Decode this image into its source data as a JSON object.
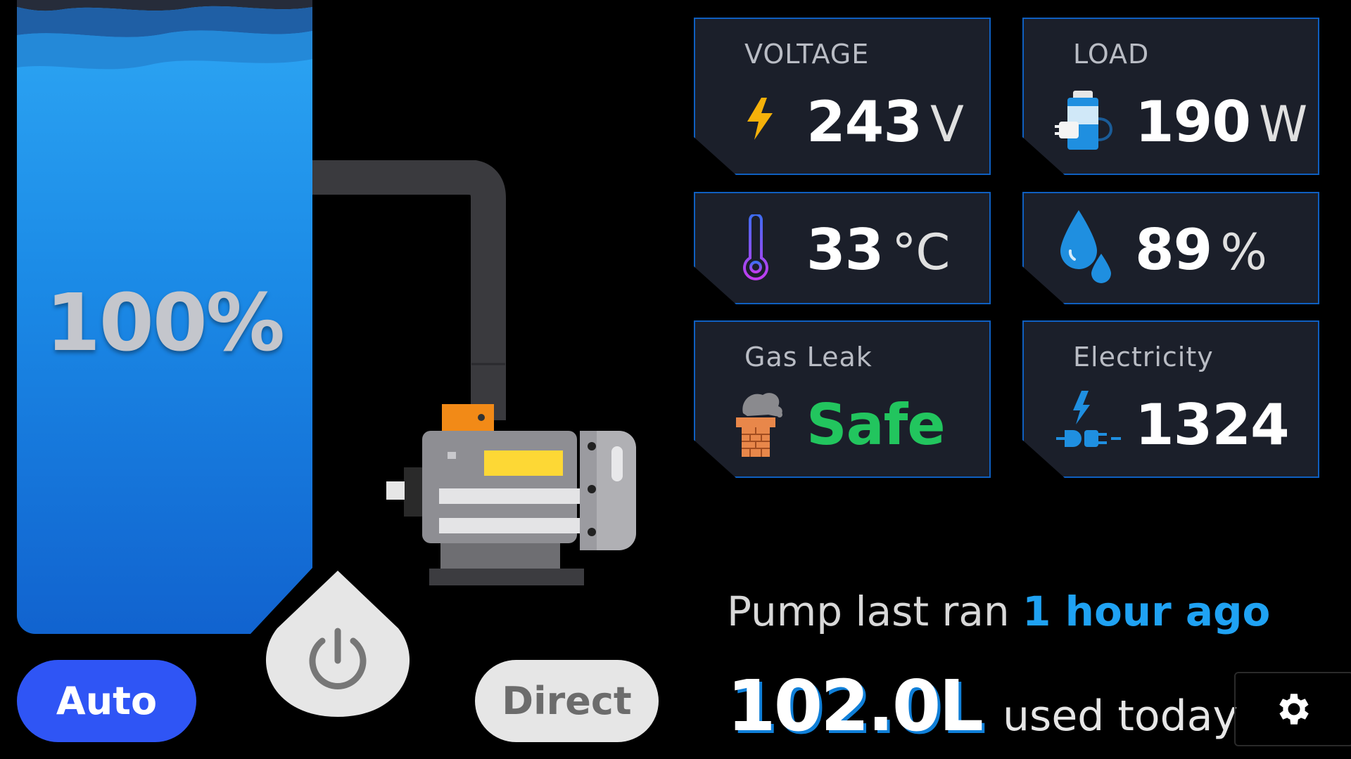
{
  "tank": {
    "level_text": "100%",
    "level_fraction": 1.0
  },
  "controls": {
    "auto_label": "Auto",
    "direct_label": "Direct"
  },
  "cards": {
    "voltage": {
      "label": "VOLTAGE",
      "value": "243",
      "unit": "V",
      "icon": "lightning-icon"
    },
    "load": {
      "label": "LOAD",
      "value": "190",
      "unit": "W",
      "icon": "appliance-icon"
    },
    "temperature": {
      "value": "33",
      "unit": "°C",
      "icon": "thermometer-icon"
    },
    "humidity": {
      "value": "89",
      "unit": "%",
      "icon": "water-drops-icon"
    },
    "gas": {
      "label": "Gas Leak",
      "value": "Safe",
      "icon": "chimney-smoke-icon",
      "value_color": "#22c55e"
    },
    "electricity": {
      "label": "Electricity",
      "value": "1324",
      "icon": "plug-icon"
    }
  },
  "status": {
    "prefix": "Pump last ran",
    "highlight": "1 hour ago"
  },
  "usage": {
    "amount": "102.0L",
    "suffix": "used today"
  },
  "icons": {
    "power": "power-icon",
    "settings": "gear-icon",
    "pump": "pump-icon"
  },
  "colors": {
    "accent": "#2f55f5",
    "water": "#1b8ae6",
    "highlight": "#1fa2f3",
    "card_border": "#0f5fc0"
  }
}
